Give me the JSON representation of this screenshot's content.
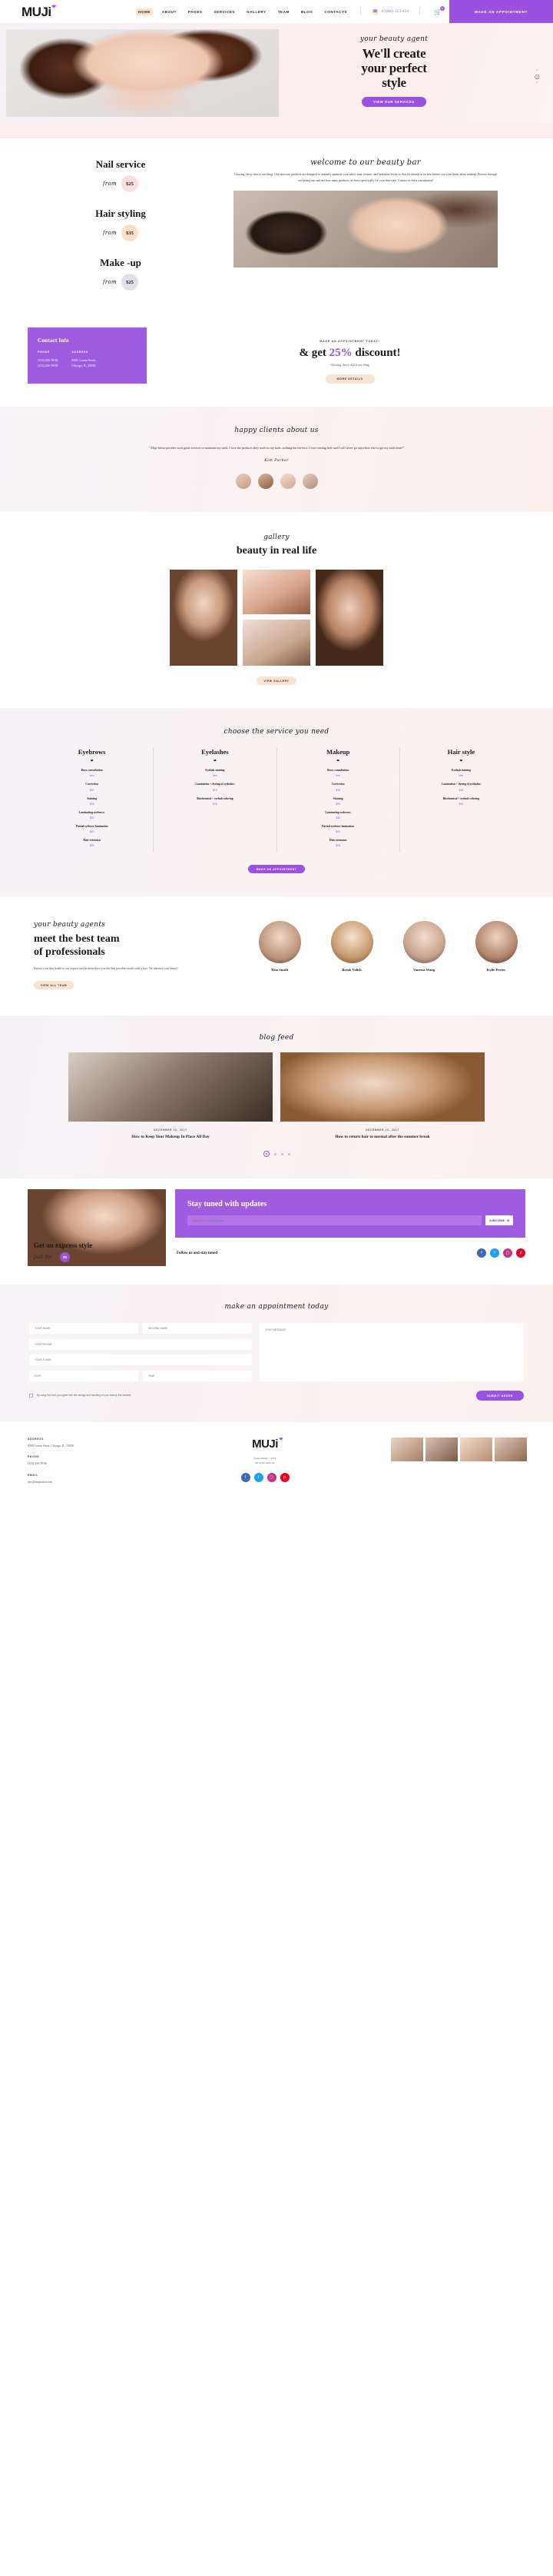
{
  "header": {
    "logo": "MUJi",
    "nav": [
      {
        "label": "HOME",
        "active": true
      },
      {
        "label": "ABOUT",
        "active": false
      },
      {
        "label": "PAGES",
        "active": false
      },
      {
        "label": "SERVICES",
        "active": false
      },
      {
        "label": "GALLERY",
        "active": false
      },
      {
        "label": "TEAM",
        "active": false
      },
      {
        "label": "BLOG",
        "active": false
      },
      {
        "label": "CONTACTS",
        "active": false
      }
    ],
    "phone": "0 (800) 123-456",
    "cart_count": "0",
    "appointment_button": "MAKE AN APPOINTMENT"
  },
  "hero": {
    "kicker": "your beauty agent",
    "title_line1": "We'll create",
    "title_line2": "your perfect",
    "title_line3": "style",
    "button": "VIEW OUR SERVICES"
  },
  "prices": {
    "items": [
      {
        "title": "Nail service",
        "from": "from",
        "price": "$25",
        "color": "b-pink"
      },
      {
        "title": "Hair styling",
        "from": "from",
        "price": "$35",
        "color": "b-peach"
      },
      {
        "title": "Make -up",
        "from": "from",
        "price": "$25",
        "color": "b-lilac"
      }
    ]
  },
  "welcome": {
    "heading": "welcome to our beauty bar",
    "paragraph": "Glowing, dewy skin is our thing. Our skin care products are designed to instantly optimize your skin's tone, texture, and hydration levels so that it's already at its best before you even think about makeup. Browse through our beauty bar and see how many products we have specifically for your skin type. Contact us for a consultation!"
  },
  "contact": {
    "title": "Contact Info",
    "phone_label": "PHONE",
    "phone_values": "(123) 456-78-90\n(123) 456-78-90",
    "address_label": "ADDRESS",
    "address_values": "8500, Lorem Street,\nChicago, IL, 55030"
  },
  "discount": {
    "kicker": "MAKE AN APPOINTMENT TODAY!",
    "title_pre": "& get ",
    "title_accent": "25%",
    "title_post": " discount!",
    "subtitle": "Glowing, dewy skin is our thing",
    "button": "MORE DETAILS"
  },
  "testimonial": {
    "heading": "happy clients about us",
    "quote": "\" Muji Salon provides such great services to maintain my nails. I love the products they used on my nails, nothing but the best. I love coming here and I will never go anywhere else to get my nails done!\"",
    "author": "Kim Parker"
  },
  "gallery": {
    "kicker": "gallery",
    "heading": "beauty in real life",
    "button": "VIEW GALLERY"
  },
  "services": {
    "heading": "choose the service you need",
    "columns": [
      {
        "title": "Eyebrows",
        "items": [
          {
            "name": "Brow consultation",
            "price": "free"
          },
          {
            "name": "Correction",
            "price": "$15"
          },
          {
            "name": "Staining",
            "price": "$25"
          },
          {
            "name": "Laminating eyebrows",
            "price": "$30"
          },
          {
            "name": "Partial eyebrow lamination",
            "price": "$20"
          },
          {
            "name": "Hair extension",
            "price": "$25"
          }
        ]
      },
      {
        "title": "Eyelashes",
        "items": [
          {
            "name": "Eyelash staining",
            "price": "free"
          },
          {
            "name": "Lamination + dyeing of eyelashes",
            "price": "$15"
          },
          {
            "name": "Biochemical + eyelash coloring",
            "price": "$25"
          }
        ]
      },
      {
        "title": "Makeup",
        "items": [
          {
            "name": "Brow consultation",
            "price": "free"
          },
          {
            "name": "Correction",
            "price": "$15"
          },
          {
            "name": "Staining",
            "price": "$25"
          },
          {
            "name": "Laminating eyebrows",
            "price": "$30"
          },
          {
            "name": "Partial eyebrow lamination",
            "price": "$20"
          },
          {
            "name": "Hair extension",
            "price": "$25"
          }
        ]
      },
      {
        "title": "Hair style",
        "items": [
          {
            "name": "Eyelash staining",
            "price": "free"
          },
          {
            "name": "Lamination + dyeing of eyelashes",
            "price": "$15"
          },
          {
            "name": "Biochemical + eyelash coloring",
            "price": "$25"
          }
        ]
      }
    ],
    "button": "MAKE AN APPOINTMENT"
  },
  "team": {
    "kicker": "your beauty agents",
    "title_line1": "meet the best team",
    "title_line2": "of professionals",
    "paragraph": "Entrust your skin health to our experts and let them show you the best possible results with a face. We enhance your beauty!",
    "button": "VIEW ALL TEAM",
    "members": [
      {
        "name": "Tina Smith",
        "photo": "m1"
      },
      {
        "name": "Brook Volish",
        "photo": "m2"
      },
      {
        "name": "Vanessa Wang",
        "photo": "m3"
      },
      {
        "name": "Kylie Porter",
        "photo": "m4"
      }
    ]
  },
  "blog": {
    "heading": "blog feed",
    "posts": [
      {
        "date": "DECEMBER 10, 2017",
        "title": "How to Keep Your Makeup In Place All Day",
        "photo": "p1"
      },
      {
        "date": "DECEMBER 10, 2017",
        "title": "How to return hair to normal after the summer break",
        "photo": "p2"
      }
    ]
  },
  "express": {
    "title": "Get an express style",
    "subtitle": "just for",
    "badge": "$5"
  },
  "newsletter": {
    "title": "Stay tuned with updates",
    "placeholder": "Enter your e-mail address",
    "button": "SUBSCRIBE",
    "follow_text": "Follow us and stay tuned",
    "socials": [
      "facebook-icon",
      "twitter-icon",
      "instagram-icon",
      "pinterest-icon"
    ]
  },
  "appointment": {
    "heading": "make an appointment today",
    "fields": [
      {
        "placeholder": "YOUR NAME",
        "value": ""
      },
      {
        "placeholder": "SECOND NAME",
        "value": ""
      },
      {
        "placeholder": "YOUR PHONE",
        "value": ""
      },
      {
        "placeholder": "YOUR E-MAIL",
        "value": ""
      },
      {
        "placeholder": "DATE",
        "value": ""
      },
      {
        "placeholder": "TIME",
        "value": ""
      }
    ],
    "message_placeholder": "YOUR MESSAGE",
    "consent": "By using this form you agree with the storage and handling of your data by this website.",
    "submit": "SUBMIT ORDER"
  },
  "footer": {
    "address_label": "ADDRESS",
    "address_value": "8500 Lorem Street, Chicago, IL, 55030",
    "phone_label": "PHONE",
    "phone_value": "(123) 456-78-90",
    "email_label": "EMAIL",
    "email_value": "info@mujisalon.com",
    "logo": "MUJi",
    "copyright": "beauty/theme © 2019.\nAll rights reserved.",
    "socials": [
      "facebook-icon",
      "twitter-icon",
      "instagram-icon",
      "pinterest-icon"
    ]
  }
}
